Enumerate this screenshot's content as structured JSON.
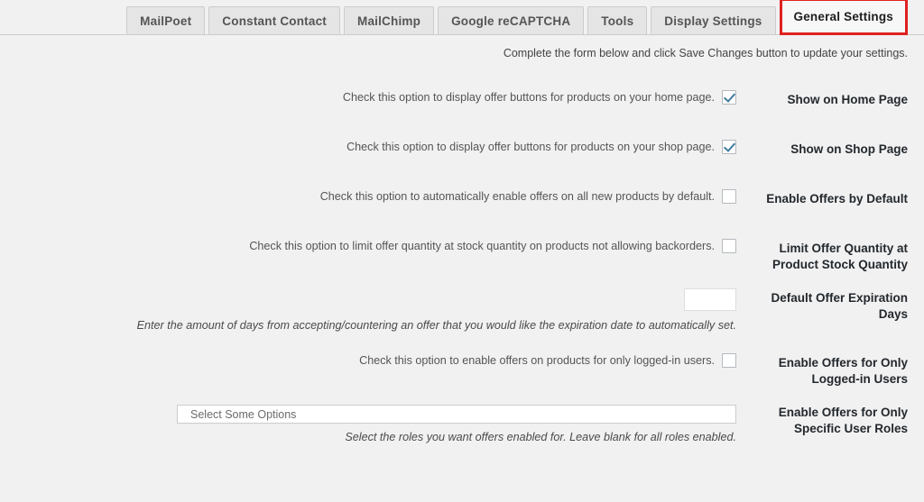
{
  "tabs": [
    {
      "label": "MailPoet",
      "active": false
    },
    {
      "label": "Constant Contact",
      "active": false
    },
    {
      "label": "MailChimp",
      "active": false
    },
    {
      "label": "Google reCAPTCHA",
      "active": false
    },
    {
      "label": "Tools",
      "active": false
    },
    {
      "label": "Display Settings",
      "active": false
    },
    {
      "label": "General Settings",
      "active": true
    }
  ],
  "intro": ".Complete the form below and click Save Changes button to update your settings",
  "accent_color": "#e02020",
  "checkbox_check_color": "#3f7d9e",
  "rows": {
    "home_page": {
      "label": "Show on Home Page",
      "description": ".Check this option to display offer buttons for products on your home page",
      "checked": true
    },
    "shop_page": {
      "label": "Show on Shop Page",
      "description": ".Check this option to display offer buttons for products on your shop page",
      "checked": true
    },
    "enable_default": {
      "label": "Enable Offers by Default",
      "description": ".Check this option to automatically enable offers on all new products by default",
      "checked": false
    },
    "limit_quantity": {
      "label": "Limit Offer Quantity at Product Stock Quantity",
      "label_line1": "Limit Offer Quantity at",
      "label_line2": "Product Stock Quantity",
      "description": ".Check this option to limit offer quantity at stock quantity on products not allowing backorders",
      "checked": false
    },
    "expiration_days": {
      "label": "Default Offer Expiration Days",
      "label_line1": "Default Offer Expiration",
      "label_line2": "Days",
      "value": "",
      "placeholder": "",
      "hint": ".Enter the amount of days from accepting/countering an offer that you would like the expiration date to automatically set"
    },
    "logged_in_only": {
      "label": "Enable Offers for Only Logged-in Users",
      "label_line1": "Enable Offers for Only",
      "label_line2": "Logged-in Users",
      "description": ".Check this option to enable offers on products for only logged-in users",
      "checked": false
    },
    "user_roles": {
      "label": "Enable Offers for Only Specific User Roles",
      "label_line1": "Enable Offers for Only",
      "label_line2": "Specific User Roles",
      "select_placeholder": "Select Some Options",
      "selected_value": "",
      "hint": ".Select the roles you want offers enabled for. Leave blank for all roles enabled"
    }
  }
}
